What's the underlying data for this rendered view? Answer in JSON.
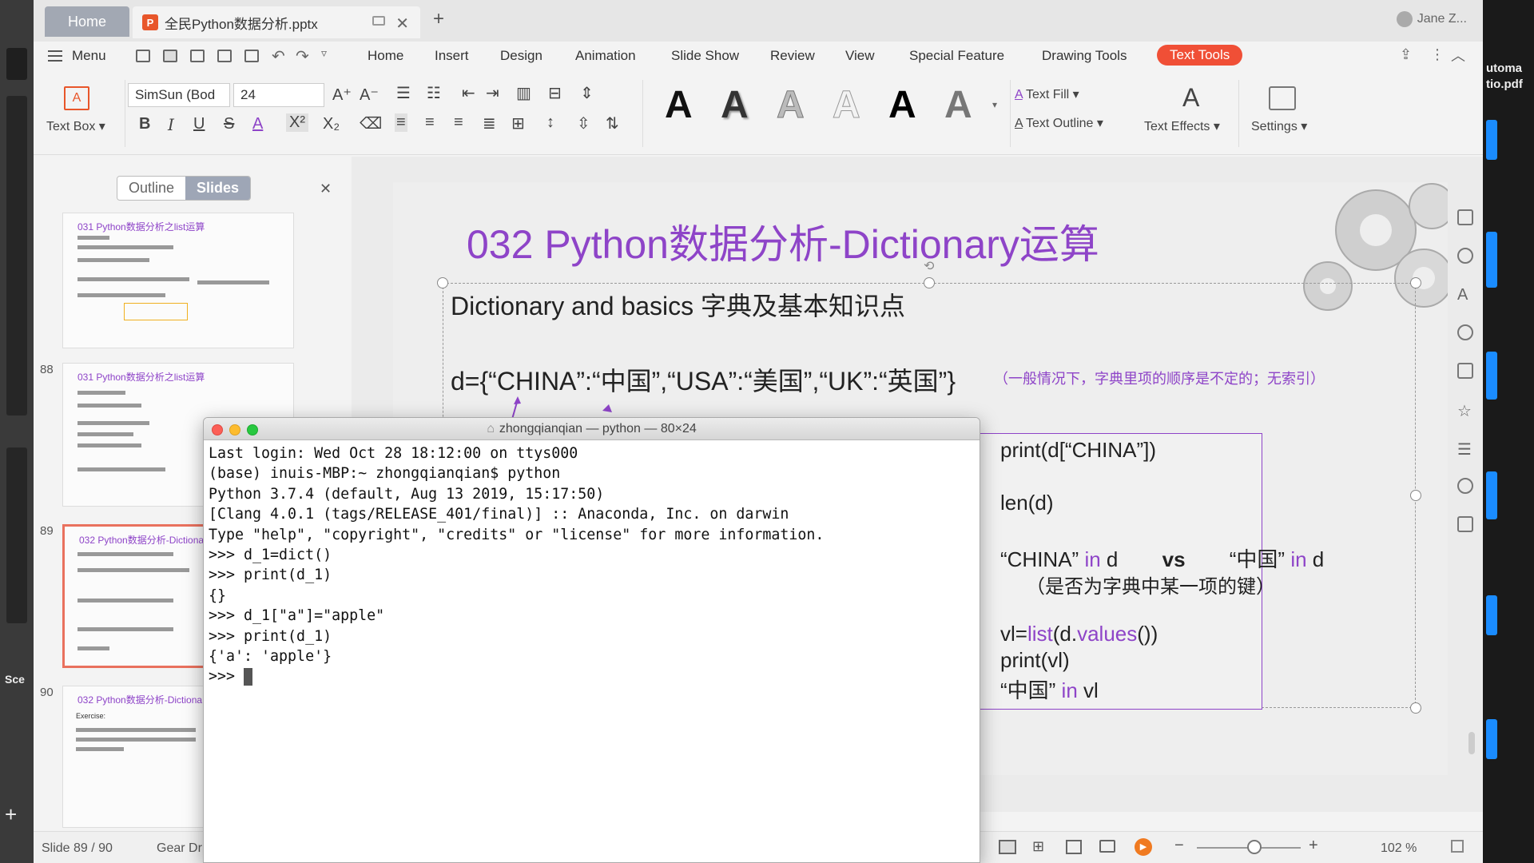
{
  "app": {
    "tab_home": "Home",
    "doc_tab": "全民Python数据分析.pptx",
    "user_name": "Jane Z..."
  },
  "menubar": {
    "menu_label": "Menu",
    "tabs": [
      "Home",
      "Insert",
      "Design",
      "Animation",
      "Slide Show",
      "Review",
      "View",
      "Special Feature",
      "Drawing Tools",
      "Text Tools"
    ],
    "active_tab": "Text Tools",
    "accent": "#f04f36"
  },
  "ribbon": {
    "text_box": "Text Box",
    "font_name": "SimSun (Bod",
    "font_size": "24",
    "text_fill": "Text Fill",
    "text_outline": "Text Outline",
    "text_effects": "Text Effects",
    "settings": "Settings",
    "style_glyph": "A"
  },
  "panel": {
    "outline_label": "Outline",
    "slides_label": "Slides",
    "thumbs": [
      {
        "num": "",
        "title": "031 Python数据分析之list运算"
      },
      {
        "num": "88",
        "title": "031 Python数据分析之list运算"
      },
      {
        "num": "89",
        "title": "032 Python数据分析-Dictiona"
      },
      {
        "num": "90",
        "title": "032 Python数据分析-Dictiona"
      }
    ],
    "thumb90_text": "Exercise:"
  },
  "slide": {
    "title": "032 Python数据分析-Dictionary运算",
    "subtitle": "Dictionary and basics 字典及基本知识点",
    "dict_prefix": "d=",
    "dict_line": "{“CHINA”:“中国”,“USA”:“美国”,“UK”:“英国”}",
    "note": "（一般情况下，字典里项的顺序是不定的；无索引）",
    "code": {
      "l1": "print(d[“CHINA”])",
      "l2": "len(d)",
      "l3a": "“CHINA” ",
      "l3b": "in",
      "l3c": " d",
      "l3vs": "vs",
      "l3d": "“中国” ",
      "l3e": "in",
      "l3f": " d",
      "l4": "（是否为字典中某一项的键）",
      "l5a": "vl=",
      "l5b": "list",
      "l5c": "(d.",
      "l5d": "values",
      "l5e": "())",
      "l6": "print(vl)",
      "l7a": "“中国” ",
      "l7b": "in",
      "l7c": " vl"
    }
  },
  "terminal": {
    "title": "zhongqianqian — python — 80×24",
    "lines": [
      "Last login: Wed Oct 28 18:12:00 on ttys000",
      "(base) inuis-MBP:~ zhongqianqian$ python",
      "Python 3.7.4 (default, Aug 13 2019, 15:17:50)",
      "[Clang 4.0.1 (tags/RELEASE_401/final)] :: Anaconda, Inc. on darwin",
      "Type \"help\", \"copyright\", \"credits\" or \"license\" for more information.",
      ">>> d_1=dict()",
      ">>> print(d_1)",
      "{}",
      ">>> d_1[\"a\"]=\"apple\"",
      ">>> print(d_1)",
      "{'a': 'apple'}"
    ],
    "prompt": ">>> "
  },
  "status": {
    "slide_pos": "Slide 89 / 90",
    "theme": "Gear Dr",
    "zoom": "102 %",
    "zoom_level": 0.55
  },
  "desktop": {
    "right_label1": "utoma",
    "right_label2": "tio.pdf",
    "left_label": "Sce"
  }
}
